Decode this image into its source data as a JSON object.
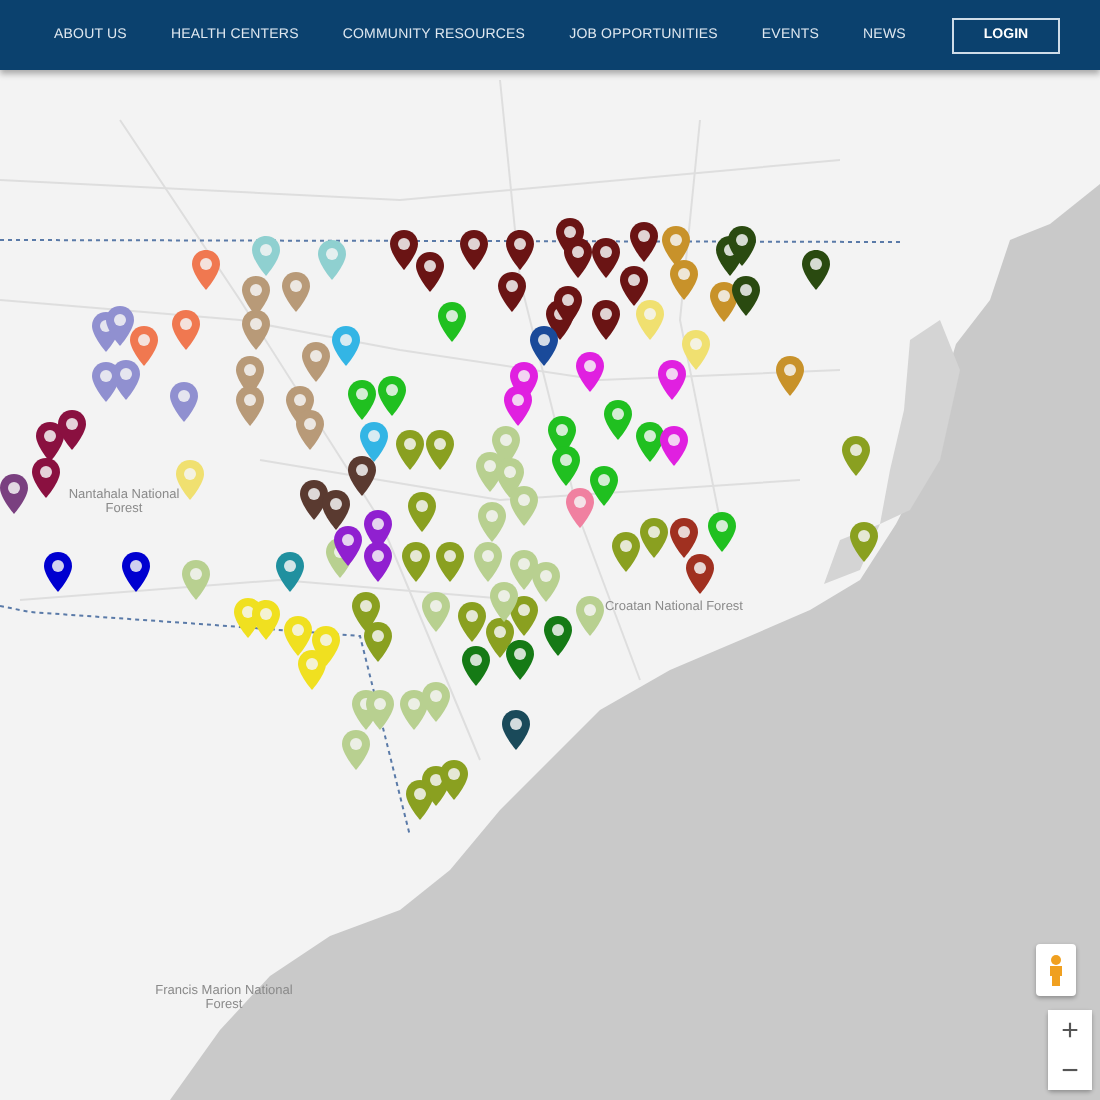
{
  "nav": {
    "items": [
      {
        "label": "ABOUT US"
      },
      {
        "label": "HEALTH CENTERS"
      },
      {
        "label": "COMMUNITY RESOURCES"
      },
      {
        "label": "JOB OPPORTUNITIES"
      },
      {
        "label": "EVENTS"
      },
      {
        "label": "NEWS"
      }
    ],
    "login": "LOGIN"
  },
  "map": {
    "labels": [
      "Nantahala National Forest",
      "Croatan National Forest",
      "Francis Marion National Forest"
    ],
    "zoom_in": "+",
    "zoom_out": "−",
    "pins": [
      {
        "color": "#f07850"
      },
      {
        "color": "#f07850"
      },
      {
        "color": "#f07850"
      },
      {
        "color": "#8fd0d0"
      },
      {
        "color": "#8fd0d0"
      },
      {
        "color": "#b89a78"
      },
      {
        "color": "#b89a78"
      },
      {
        "color": "#b89a78"
      },
      {
        "color": "#b89a78"
      },
      {
        "color": "#b89a78"
      },
      {
        "color": "#b89a78"
      },
      {
        "color": "#b89a78"
      },
      {
        "color": "#b89a78"
      },
      {
        "color": "#33b5e5"
      },
      {
        "color": "#33b5e5"
      },
      {
        "color": "#6a1414"
      },
      {
        "color": "#6a1414"
      },
      {
        "color": "#6a1414"
      },
      {
        "color": "#6a1414"
      },
      {
        "color": "#6a1414"
      },
      {
        "color": "#6a1414"
      },
      {
        "color": "#6a1414"
      },
      {
        "color": "#6a1414"
      },
      {
        "color": "#6a1414"
      },
      {
        "color": "#6a1414"
      },
      {
        "color": "#6a1414"
      },
      {
        "color": "#6a1414"
      },
      {
        "color": "#6a1414"
      },
      {
        "color": "#c8922a"
      },
      {
        "color": "#c8922a"
      },
      {
        "color": "#c8922a"
      },
      {
        "color": "#c8922a"
      },
      {
        "color": "#2a4a10"
      },
      {
        "color": "#2a4a10"
      },
      {
        "color": "#2a4a10"
      },
      {
        "color": "#2a4a10"
      },
      {
        "color": "#20c020"
      },
      {
        "color": "#20c020"
      },
      {
        "color": "#20c020"
      },
      {
        "color": "#20c020"
      },
      {
        "color": "#20c020"
      },
      {
        "color": "#20c020"
      },
      {
        "color": "#20c020"
      },
      {
        "color": "#20c020"
      },
      {
        "color": "#20c020"
      },
      {
        "color": "#1a4a9a"
      },
      {
        "color": "#e020e0"
      },
      {
        "color": "#e020e0"
      },
      {
        "color": "#e020e0"
      },
      {
        "color": "#e020e0"
      },
      {
        "color": "#e020e0"
      },
      {
        "color": "#f0e070"
      },
      {
        "color": "#f0e070"
      },
      {
        "color": "#f0e070"
      },
      {
        "color": "#9090d0"
      },
      {
        "color": "#9090d0"
      },
      {
        "color": "#9090d0"
      },
      {
        "color": "#9090d0"
      },
      {
        "color": "#9090d0"
      },
      {
        "color": "#8a1040"
      },
      {
        "color": "#8a1040"
      },
      {
        "color": "#8a1040"
      },
      {
        "color": "#7a4080"
      },
      {
        "color": "#8aa020"
      },
      {
        "color": "#8aa020"
      },
      {
        "color": "#8aa020"
      },
      {
        "color": "#8aa020"
      },
      {
        "color": "#8aa020"
      },
      {
        "color": "#8aa020"
      },
      {
        "color": "#8aa020"
      },
      {
        "color": "#8aa020"
      },
      {
        "color": "#8aa020"
      },
      {
        "color": "#8aa020"
      },
      {
        "color": "#8aa020"
      },
      {
        "color": "#8aa020"
      },
      {
        "color": "#8aa020"
      },
      {
        "color": "#8aa020"
      },
      {
        "color": "#8aa020"
      },
      {
        "color": "#8aa020"
      },
      {
        "color": "#8aa020"
      },
      {
        "color": "#b8d090"
      },
      {
        "color": "#b8d090"
      },
      {
        "color": "#b8d090"
      },
      {
        "color": "#b8d090"
      },
      {
        "color": "#b8d090"
      },
      {
        "color": "#b8d090"
      },
      {
        "color": "#b8d090"
      },
      {
        "color": "#b8d090"
      },
      {
        "color": "#b8d090"
      },
      {
        "color": "#b8d090"
      },
      {
        "color": "#b8d090"
      },
      {
        "color": "#b8d090"
      },
      {
        "color": "#b8d090"
      },
      {
        "color": "#b8d090"
      },
      {
        "color": "#b8d090"
      },
      {
        "color": "#b8d090"
      },
      {
        "color": "#b8d090"
      },
      {
        "color": "#b8d090"
      },
      {
        "color": "#5a3a30"
      },
      {
        "color": "#5a3a30"
      },
      {
        "color": "#5a3a30"
      },
      {
        "color": "#9020d0"
      },
      {
        "color": "#9020d0"
      },
      {
        "color": "#9020d0"
      },
      {
        "color": "#0000d0"
      },
      {
        "color": "#0000d0"
      },
      {
        "color": "#20909f"
      },
      {
        "color": "#1a4a5a"
      },
      {
        "color": "#f0e020"
      },
      {
        "color": "#f0e020"
      },
      {
        "color": "#f0e020"
      },
      {
        "color": "#f0e020"
      },
      {
        "color": "#f0e020"
      },
      {
        "color": "#157a15"
      },
      {
        "color": "#157a15"
      },
      {
        "color": "#157a15"
      },
      {
        "color": "#f080a0"
      },
      {
        "color": "#a03020"
      },
      {
        "color": "#a03020"
      }
    ]
  }
}
